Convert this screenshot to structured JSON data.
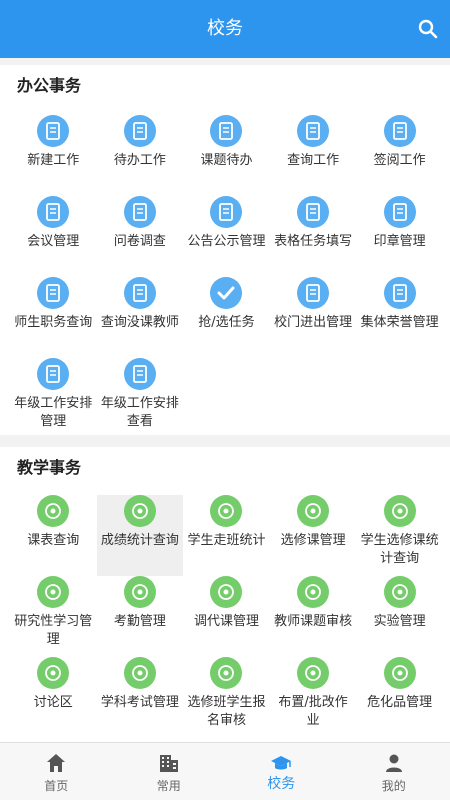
{
  "header": {
    "title": "校务",
    "search_icon": "search-icon"
  },
  "office": {
    "title": "办公事务",
    "items": [
      {
        "label": "新建工作",
        "icon": "folder-plus-icon"
      },
      {
        "label": "待办工作",
        "icon": "doc-clock-icon"
      },
      {
        "label": "课题待办",
        "icon": "doc-list-icon"
      },
      {
        "label": "查询工作",
        "icon": "doc-search-icon"
      },
      {
        "label": "签阅工作",
        "icon": "edit-doc-icon"
      },
      {
        "label": "会议管理",
        "icon": "group-icon"
      },
      {
        "label": "问卷调查",
        "icon": "survey-icon"
      },
      {
        "label": "公告公示管理",
        "icon": "notice-board-icon"
      },
      {
        "label": "表格任务填写",
        "icon": "form-icon"
      },
      {
        "label": "印章管理",
        "icon": "stamp-icon"
      },
      {
        "label": "师生职务查询",
        "icon": "id-card-icon"
      },
      {
        "label": "查询没课教师",
        "icon": "teacher-search-icon"
      },
      {
        "label": "抢/选任务",
        "icon": "check-icon"
      },
      {
        "label": "校门进出管理",
        "icon": "gate-icon"
      },
      {
        "label": "集体荣誉管理",
        "icon": "honor-icon"
      },
      {
        "label": "年级工作安排管理",
        "icon": "edit-doc-icon"
      },
      {
        "label": "年级工作安排查看",
        "icon": "doc-view-icon"
      }
    ]
  },
  "teaching": {
    "title": "教学事务",
    "items": [
      {
        "label": "课表查询",
        "icon": "schedule-search-icon"
      },
      {
        "label": "成绩统计查询",
        "icon": "grade-icon"
      },
      {
        "label": "学生走班统计",
        "icon": "calendar-icon"
      },
      {
        "label": "选修课管理",
        "icon": "elective-icon"
      },
      {
        "label": "学生选修课统计查询",
        "icon": "book-icon"
      },
      {
        "label": "研究性学习管理",
        "icon": "bulb-icon"
      },
      {
        "label": "考勤管理",
        "icon": "hand-icon"
      },
      {
        "label": "调代课管理",
        "icon": "swap-bulb-icon"
      },
      {
        "label": "教师课题审核",
        "icon": "review-icon"
      },
      {
        "label": "实验管理",
        "icon": "flask-icon"
      },
      {
        "label": "讨论区",
        "icon": "chat-icon"
      },
      {
        "label": "学科考试管理",
        "icon": "exam-book-icon"
      },
      {
        "label": "选修班学生报名审核",
        "icon": "signup-icon"
      },
      {
        "label": "布置/批改作业",
        "icon": "homework-icon"
      },
      {
        "label": "危化品管理",
        "icon": "hazard-flask-icon"
      }
    ]
  },
  "tabs": [
    {
      "label": "首页",
      "icon": "home-icon"
    },
    {
      "label": "常用",
      "icon": "building-icon"
    },
    {
      "label": "校务",
      "icon": "graduation-cap-icon",
      "active": true
    },
    {
      "label": "我的",
      "icon": "person-icon"
    }
  ],
  "colors": {
    "header": "#2e95ef",
    "blue_icon": "#5aaef2",
    "green_icon": "#74cd6a"
  }
}
